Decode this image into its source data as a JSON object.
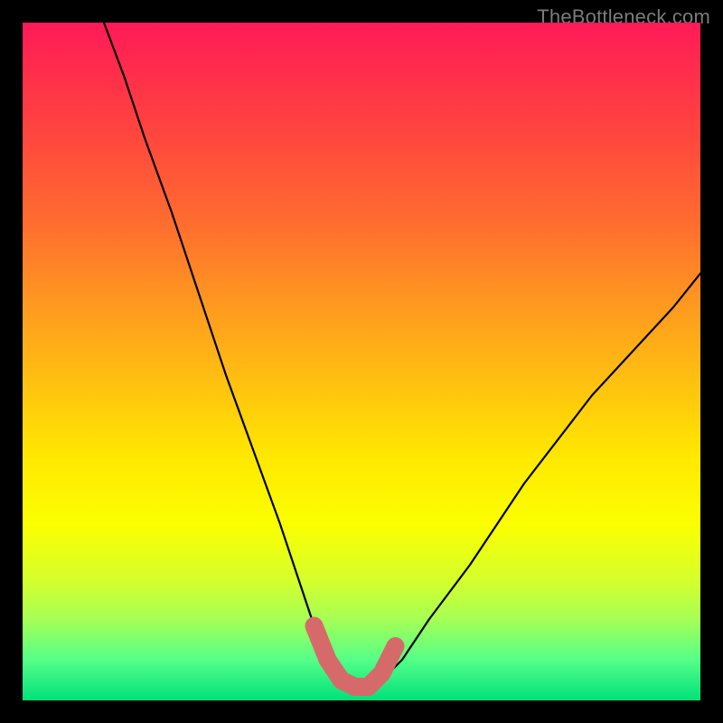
{
  "watermark": "TheBottleneck.com",
  "chart_data": {
    "type": "line",
    "title": "",
    "xlabel": "",
    "ylabel": "",
    "xlim": [
      0,
      100
    ],
    "ylim": [
      0,
      100
    ],
    "series": [
      {
        "name": "curve",
        "x": [
          12,
          15,
          18,
          22,
          26,
          30,
          34,
          38,
          41,
          43,
          45,
          47,
          49,
          51,
          53,
          56,
          60,
          66,
          74,
          84,
          96,
          100
        ],
        "y": [
          100,
          92,
          83,
          72,
          60,
          48,
          37,
          26,
          17,
          11,
          6,
          3,
          2,
          2,
          3,
          6,
          12,
          20,
          32,
          45,
          58,
          63
        ]
      }
    ],
    "highlight": {
      "name": "low-bottleneck-band",
      "x": [
        43,
        45,
        47,
        49,
        51,
        53,
        55
      ],
      "y": [
        11,
        6,
        3,
        2,
        2,
        4,
        8
      ],
      "color": "#d66a6a",
      "stroke_width_px": 20
    },
    "colors": {
      "curve_stroke": "#000000",
      "highlight_stroke": "#d66a6a",
      "gradient_top": "#ff1a58",
      "gradient_bottom": "#00e07a",
      "frame": "#000000"
    }
  }
}
